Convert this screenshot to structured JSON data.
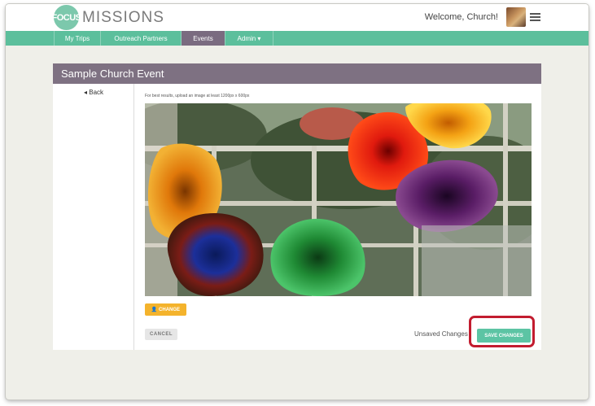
{
  "header": {
    "logo_mark": "FOCUS",
    "logo_text": "MISSIONS",
    "welcome": "Welcome, Church!",
    "icons": {
      "avatar": "user-avatar",
      "menu": "hamburger-menu-icon"
    }
  },
  "nav": {
    "items": [
      {
        "label": "My Trips",
        "active": false
      },
      {
        "label": "Outreach Partners",
        "active": false
      },
      {
        "label": "Events",
        "active": true
      },
      {
        "label": "Admin ▾",
        "active": false
      }
    ]
  },
  "event": {
    "title": "Sample Church Event",
    "back_label": "◂ Back",
    "image_hint": "For best results, upload an image at least 1200px x 600px",
    "change_label": "👤 CHANGE",
    "cancel_label": "CANCEL",
    "unsaved_label": "Unsaved Changes",
    "save_label": "SAVE CHANGES"
  },
  "colors": {
    "brand_green": "#5cbf9c",
    "nav_active": "#7a6b80",
    "title_bar": "#7e7182",
    "change_button": "#f4b32c",
    "save_button": "#5cc4a4",
    "highlight_outline": "#c21c2f"
  }
}
